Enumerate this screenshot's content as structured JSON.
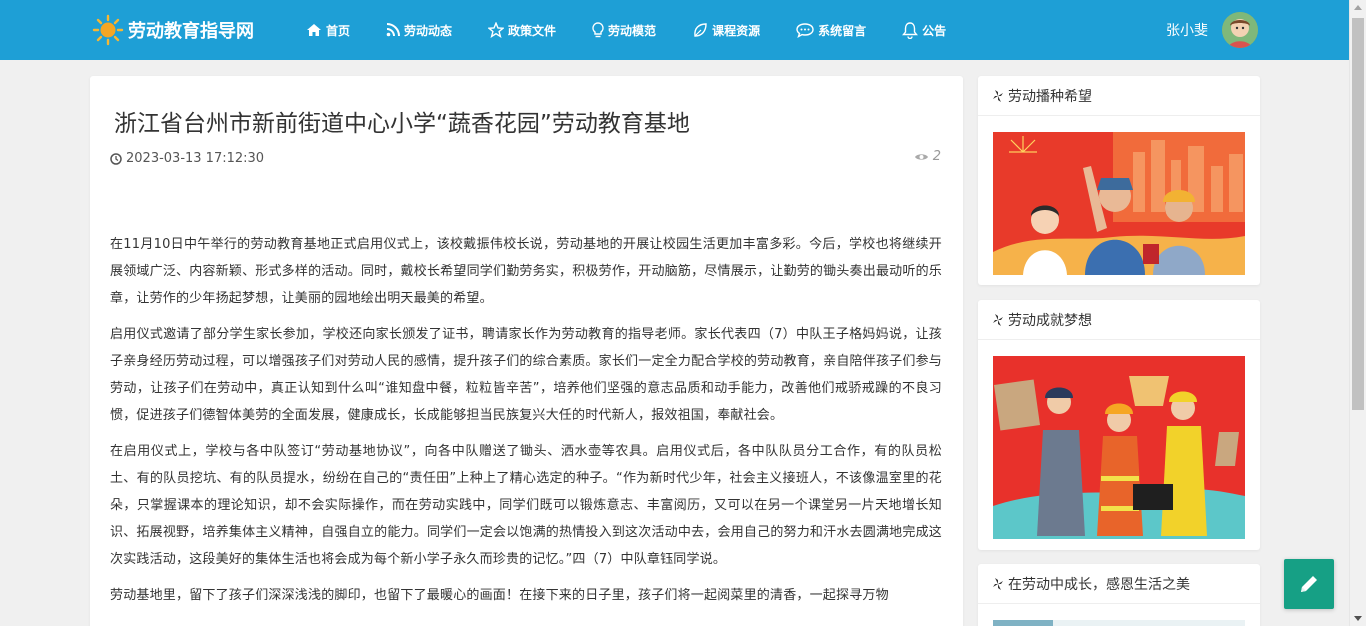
{
  "site": {
    "logo_text": "劳动教育指导网"
  },
  "nav": [
    {
      "label": "首页",
      "icon": "home-icon"
    },
    {
      "label": "劳动动态",
      "icon": "rss-icon"
    },
    {
      "label": "政策文件",
      "icon": "star-icon"
    },
    {
      "label": "劳动模范",
      "icon": "lightbulb-icon"
    },
    {
      "label": "课程资源",
      "icon": "leaf-icon"
    },
    {
      "label": "系统留言",
      "icon": "chat-icon"
    },
    {
      "label": "公告",
      "icon": "bell-icon"
    }
  ],
  "user": {
    "name": "张小斐"
  },
  "article": {
    "title": "浙江省台州市新前街道中心小学“蔬香花园”劳动教育基地",
    "datetime": "2023-03-13 17:12:30",
    "views": "2",
    "paragraphs": [
      "在11月10日中午举行的劳动教育基地正式启用仪式上，该校戴振伟校长说，劳动基地的开展让校园生活更加丰富多彩。今后，学校也将继续开展领域广泛、内容新颖、形式多样的活动。同时，戴校长希望同学们勤劳务实，积极劳作，开动脑筋，尽情展示，让勤劳的锄头奏出最动听的乐章，让劳作的少年扬起梦想，让美丽的园地绘出明天最美的希望。",
      "启用仪式邀请了部分学生家长参加，学校还向家长颁发了证书，聘请家长作为劳动教育的指导老师。家长代表四（7）中队王子格妈妈说，让孩子亲身经历劳动过程，可以增强孩子们对劳动人民的感情，提升孩子们的综合素质。家长们一定全力配合学校的劳动教育，亲自陪伴孩子们参与劳动，让孩子们在劳动中，真正认知到什么叫“谁知盘中餐，粒粒皆辛苦”，培养他们坚强的意志品质和动手能力，改善他们戒骄戒躁的不良习惯，促进孩子们德智体美劳的全面发展，健康成长，长成能够担当民族复兴大任的时代新人，报效祖国，奉献社会。",
      "在启用仪式上，学校与各中队签订“劳动基地协议”，向各中队赠送了锄头、洒水壶等农具。启用仪式后，各中队队员分工合作，有的队员松土、有的队员挖坑、有的队员提水，纷纷在自己的“责任田”上种上了精心选定的种子。“作为新时代少年，社会主义接班人，不该像温室里的花朵，只掌握课本的理论知识，却不会实际操作，而在劳动实践中，同学们既可以锻炼意志、丰富阅历，又可以在另一个课堂另一片天地增长知识、拓展视野，培养集体主义精神，自强自立的能力。同学们一定会以饱满的热情投入到这次活动中去，会用自己的努力和汗水去圆满地完成这次实践活动，这段美好的集体生活也将会成为每个新小学子永久而珍贵的记忆。”四（7）中队章钰同学说。",
      "劳动基地里，留下了孩子们深深浅浅的脚印，也留下了最暖心的画面！在接下来的日子里，孩子们将一起阅菜里的清香，一起探寻万物"
    ]
  },
  "sidebar": [
    {
      "title": "劳动播种希望"
    },
    {
      "title": "劳动成就梦想"
    },
    {
      "title": "在劳动中成长，感恩生活之美"
    }
  ],
  "colors": {
    "header": "#1e9fd6",
    "fab": "#16a085"
  }
}
